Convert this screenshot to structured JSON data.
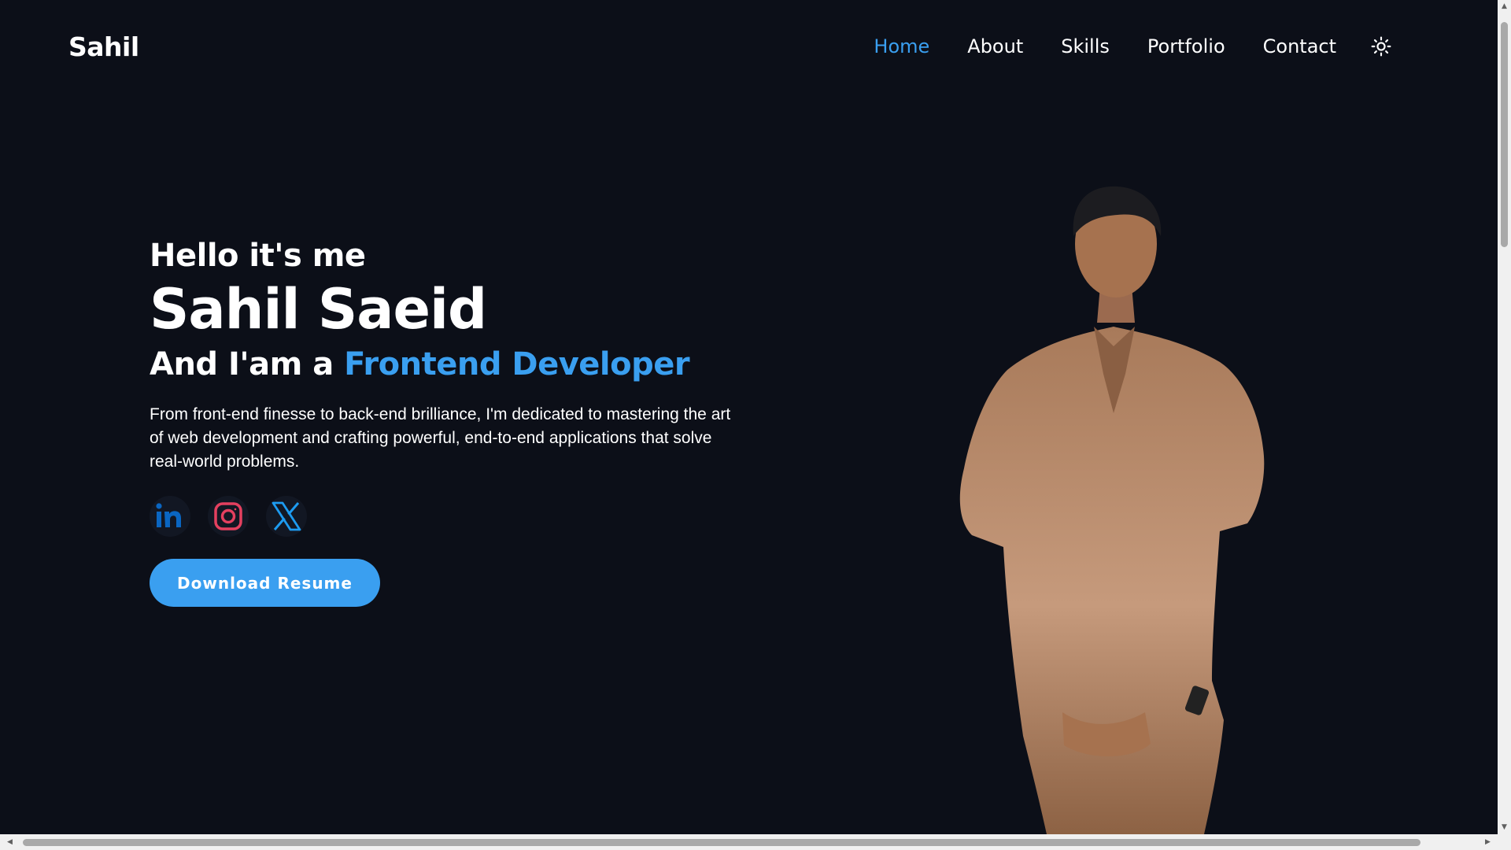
{
  "header": {
    "logo": "Sahil"
  },
  "nav": {
    "items": [
      {
        "label": "Home",
        "active": true
      },
      {
        "label": "About"
      },
      {
        "label": "Skills"
      },
      {
        "label": "Portfolio"
      },
      {
        "label": "Contact"
      }
    ],
    "theme_icon": "sun-icon"
  },
  "hero": {
    "greeting": "Hello it's me",
    "name": "Sahil Saeid",
    "role_prefix": "And I'am a ",
    "role_highlight": "Frontend Developer",
    "description": "From front-end finesse to back-end brilliance, I'm dedicated to mastering the art of web development and crafting powerful, end-to-end applications that solve real-world problems.",
    "social": [
      {
        "icon": "linkedin-icon"
      },
      {
        "icon": "instagram-icon"
      },
      {
        "icon": "x-icon"
      }
    ],
    "button": "Download Resume"
  },
  "colors": {
    "background": "#0c0f18",
    "accent": "#3a9ff0",
    "linkedin": "#0a66c2",
    "instagram": "#e4405f",
    "x": "#1d9bf0"
  }
}
